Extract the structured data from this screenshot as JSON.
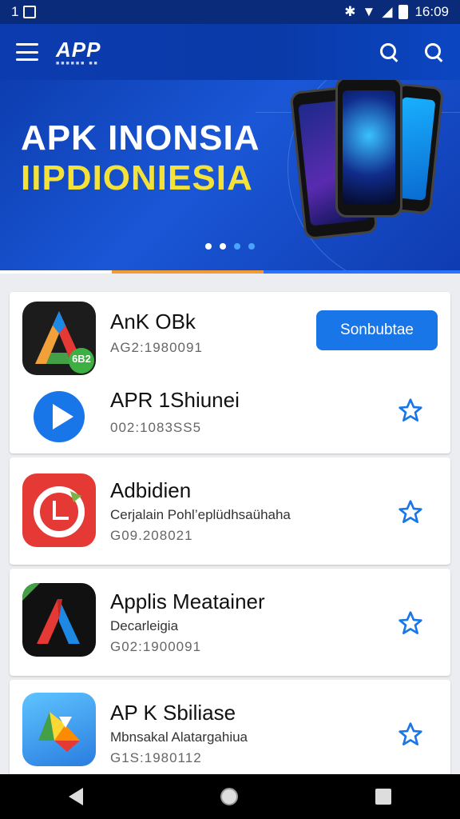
{
  "status_bar": {
    "left_text": "1",
    "time": "16:09"
  },
  "app_bar": {
    "logo_text": "APP",
    "logo_sub": "■■■■■■ ■■"
  },
  "banner": {
    "line1": "APK INONSIA",
    "line2": "IIPDIONIESIA",
    "slide_count": 4,
    "active_slide": 0
  },
  "apps": [
    {
      "name": "AnK OBk",
      "sub": "",
      "code": "AG2:1980091",
      "action": "Sonbubtae",
      "badge": "6B2"
    },
    {
      "name": "APR 1Shiunei",
      "sub": "",
      "code": "002:1083SS5",
      "action": "favorite"
    },
    {
      "name": "Adbidien",
      "sub": "Cerjalain Pohl’eplüdhsaühaha",
      "code": "G09.208021",
      "action": "favorite"
    },
    {
      "name": "Applis Meatainer",
      "sub": "Decarleigia",
      "code": "G02:1900091",
      "action": "favorite"
    },
    {
      "name": "AP K Sbiliase",
      "sub": "Mbnsakal Alatargahiua",
      "code": "G1S:1980112",
      "action": "favorite"
    }
  ],
  "colors": {
    "primary": "#0c3bb0",
    "accent_blue": "#1976e8",
    "star": "#1976e8",
    "banner_yellow": "#f4e23a"
  },
  "icons": {
    "menu": "menu-icon",
    "search": "search-icon",
    "star": "star-outline-icon",
    "back": "back-icon",
    "home": "home-icon",
    "recents": "recents-icon"
  }
}
